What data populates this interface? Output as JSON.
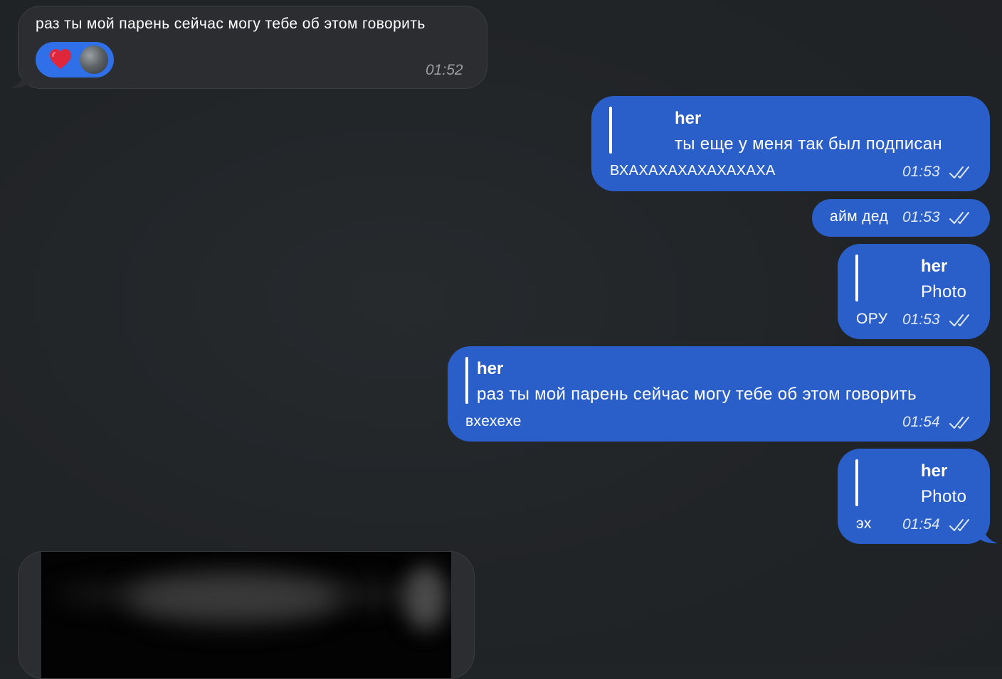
{
  "messages": [
    {
      "id": "m1",
      "direction": "incoming",
      "text": "раз ты мой парень сейчас могу тебе об этом говорить",
      "time": "01:52",
      "reaction": {
        "emoji": "❤️",
        "icon": "heart-icon",
        "avatar": "reactor-avatar"
      }
    },
    {
      "id": "m2",
      "direction": "outgoing",
      "reply": {
        "author": "her",
        "text": "ты еще у меня так был подписан"
      },
      "text": "ВХАХАХАХАХАХАХАХА",
      "time": "01:53",
      "status": "read"
    },
    {
      "id": "m3",
      "direction": "outgoing",
      "text": "айм дед",
      "time": "01:53",
      "status": "read"
    },
    {
      "id": "m4",
      "direction": "outgoing",
      "reply": {
        "author": "her",
        "text": "Photo"
      },
      "text": "ОРУ",
      "time": "01:53",
      "status": "read"
    },
    {
      "id": "m5",
      "direction": "outgoing",
      "reply": {
        "author": "her",
        "text": "раз ты мой парень сейчас могу тебе об этом говорить"
      },
      "text": "вхехехе",
      "time": "01:54",
      "status": "read"
    },
    {
      "id": "m6",
      "direction": "outgoing",
      "reply": {
        "author": "her",
        "text": "Photo"
      },
      "text": "эх",
      "time": "01:54",
      "status": "read"
    },
    {
      "id": "m7",
      "direction": "incoming",
      "media": "photo (blurred)"
    }
  ],
  "colors": {
    "background": "#212427",
    "incoming_bubble": "#2b2d30",
    "outgoing_bubble": "#2a5fc9",
    "reaction_pill": "#2f6fe8",
    "time_incoming": "#9a9da1",
    "time_outgoing": "#dfe8fb"
  }
}
